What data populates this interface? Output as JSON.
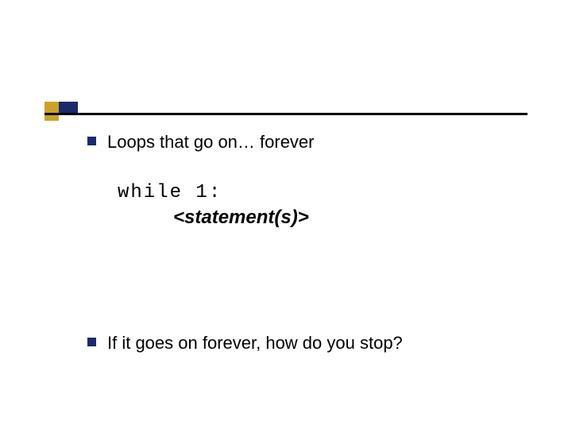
{
  "bullets": [
    "Loops that go on… forever",
    "If it goes on forever, how do you stop?"
  ],
  "code": {
    "line1": "while 1:",
    "statement": "<statement(s)>"
  },
  "colors": {
    "navy": "#1a2a6c",
    "gold": "#c9a227",
    "text": "#000000"
  }
}
